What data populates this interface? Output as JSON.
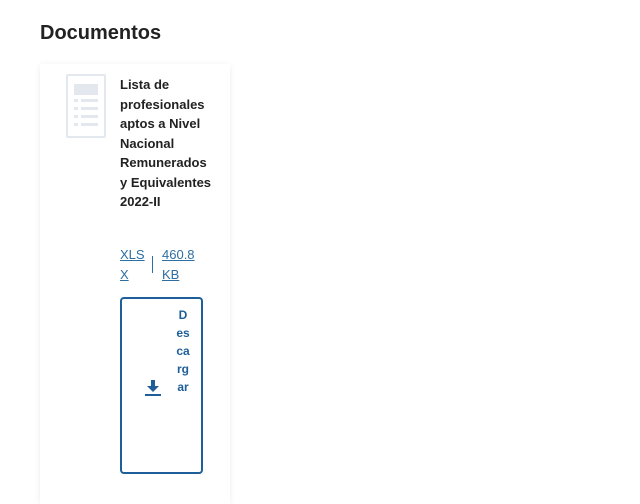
{
  "section": {
    "title": "Documentos"
  },
  "document": {
    "icon": "document-lines-icon",
    "title": "Lista de profesionales aptos a Nivel Nacional Remunerados y Equivalentes 2022-II",
    "file_type": "XLSX",
    "file_size": "460.8 KB",
    "download_label": "Descargar",
    "download_icon": "download-icon"
  },
  "colors": {
    "accent": "#1e5f99",
    "link": "#2d6ea3",
    "text": "#222222",
    "icon_gray": "#e3e8ee"
  }
}
